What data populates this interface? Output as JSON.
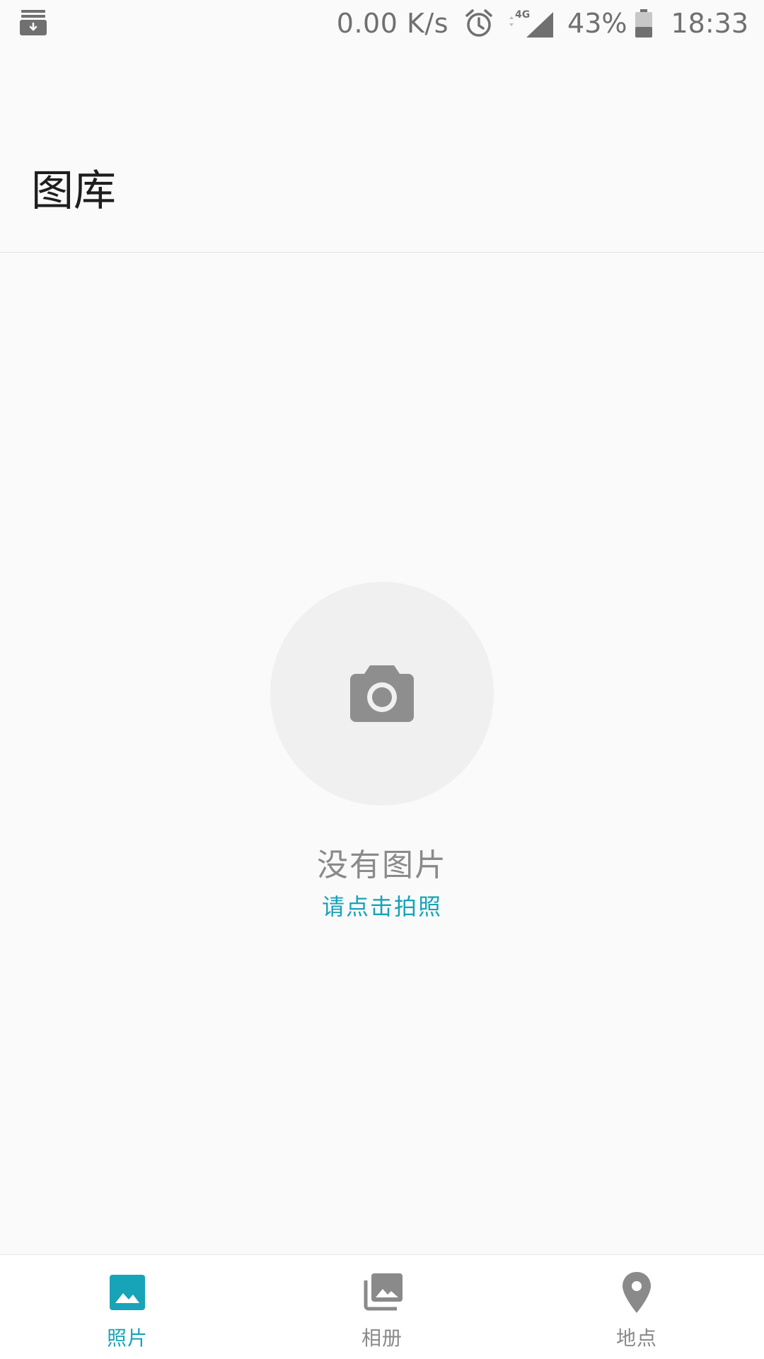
{
  "status_bar": {
    "network_speed": "0.00 K/s",
    "network_type": "4G",
    "battery_percent": "43%",
    "time": "18:33",
    "battery_level": 0.43,
    "icons": [
      "download-notification-icon",
      "alarm-icon",
      "signal-icon",
      "battery-icon"
    ]
  },
  "header": {
    "title": "图库"
  },
  "empty_state": {
    "icon": "camera-icon",
    "title": "没有图片",
    "action_label": "请点击拍照"
  },
  "bottom_nav": {
    "items": [
      {
        "label": "照片",
        "icon": "photo-icon",
        "active": true
      },
      {
        "label": "相册",
        "icon": "albums-icon",
        "active": false
      },
      {
        "label": "地点",
        "icon": "location-pin-icon",
        "active": false
      }
    ]
  },
  "colors": {
    "accent": "#17a3b8",
    "background": "#fafafa",
    "inactive": "#8a8a8a",
    "empty_circle": "#f0f0f0",
    "camera": "#8e8e8e"
  }
}
